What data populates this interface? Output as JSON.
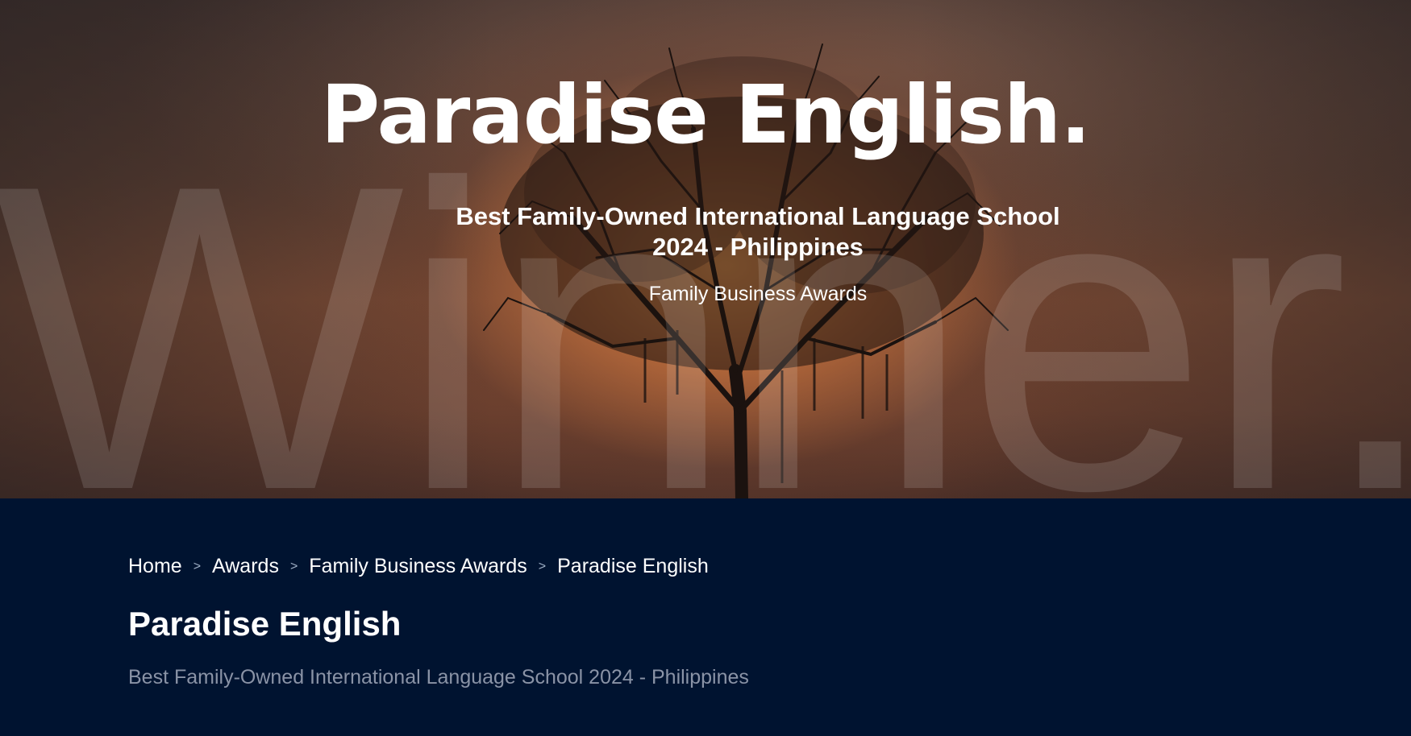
{
  "hero": {
    "watermark": "Winner.",
    "title": "Paradise English.",
    "subtitle_line1": "Best Family-Owned International Language School",
    "subtitle_line2": "2024 - Philippines",
    "organization": "Family Business Awards"
  },
  "breadcrumb": {
    "items": [
      {
        "label": "Home"
      },
      {
        "label": "Awards"
      },
      {
        "label": "Family Business Awards"
      },
      {
        "label": "Paradise English"
      }
    ],
    "separator": ">"
  },
  "main": {
    "title": "Paradise English",
    "description": "Best Family-Owned International Language School 2024 - Philippines"
  },
  "colors": {
    "content_background": "#001330",
    "muted_text": "#8a93a6",
    "sunset_orange": "#c4703c"
  }
}
